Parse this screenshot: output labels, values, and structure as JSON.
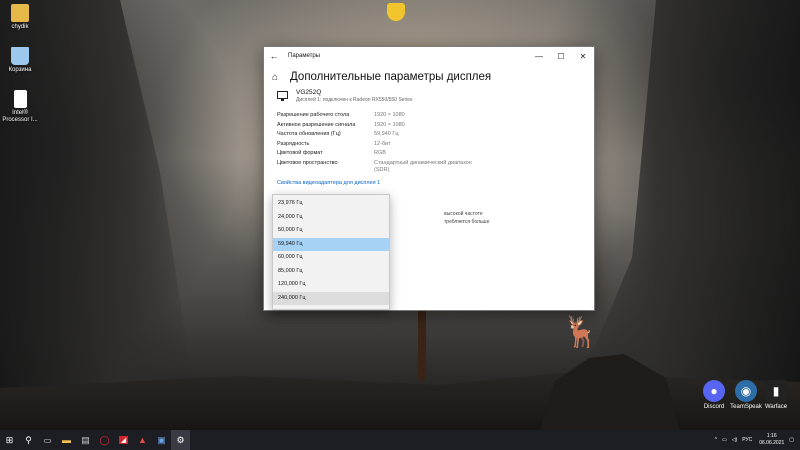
{
  "desktop": {
    "icons": [
      {
        "label": "chydik",
        "icon": "user-folder-icon",
        "color": "#e6b84a"
      },
      {
        "label": "Корзина",
        "icon": "recycle-bin-icon",
        "color": "#9cc8ee"
      },
      {
        "label": "Intel® Processor I...",
        "icon": "document-icon",
        "color": "#ffffff"
      }
    ],
    "top_icon": "security-shield-icon",
    "tray_apps": [
      {
        "label": "Discord",
        "icon": "discord-icon",
        "color": "#5865f2"
      },
      {
        "label": "TeamSpeak",
        "icon": "teamspeak-icon",
        "color": "#2d6da8"
      },
      {
        "label": "Warface",
        "icon": "warface-icon",
        "color": "#222222"
      }
    ]
  },
  "window": {
    "title": "Параметры",
    "page_title": "Дополнительные параметры дисплея",
    "monitor": {
      "name": "VG252Q",
      "description": "Дисплей 1: подключен к Radeon RX550/550 Series"
    },
    "properties": [
      {
        "key": "Разрешение рабочего стола",
        "value": "1920 × 1080"
      },
      {
        "key": "Активное разрешение сигнала",
        "value": "1920 × 1080"
      },
      {
        "key": "Частота обновления (Гц)",
        "value": "59,940 Гц"
      },
      {
        "key": "Разрядность",
        "value": "12-бит"
      },
      {
        "key": "Цветовой формат",
        "value": "RGB"
      },
      {
        "key": "Цветовое пространство",
        "value": "Стандартный динамический диапазон (SDR)"
      }
    ],
    "adapter_link": "Свойства видеоадаптера для дисплея 1",
    "partial_text_1": "высокой частоте",
    "partial_text_2": "требляется больше"
  },
  "refresh_dropdown": {
    "options": [
      "23,976 Гц",
      "24,000 Гц",
      "50,000 Гц",
      "59,940 Гц",
      "60,000 Гц",
      "85,000 Гц",
      "120,000 Гц",
      "240,000 Гц"
    ],
    "selected": "59,940 Гц"
  },
  "taskbar": {
    "language": "РУС",
    "time": "1:16",
    "date": "06.06.2021"
  },
  "colors": {
    "accent": "#0a64c8",
    "selected_option": "#a6d2f5",
    "taskbar": "#1d1e24"
  }
}
